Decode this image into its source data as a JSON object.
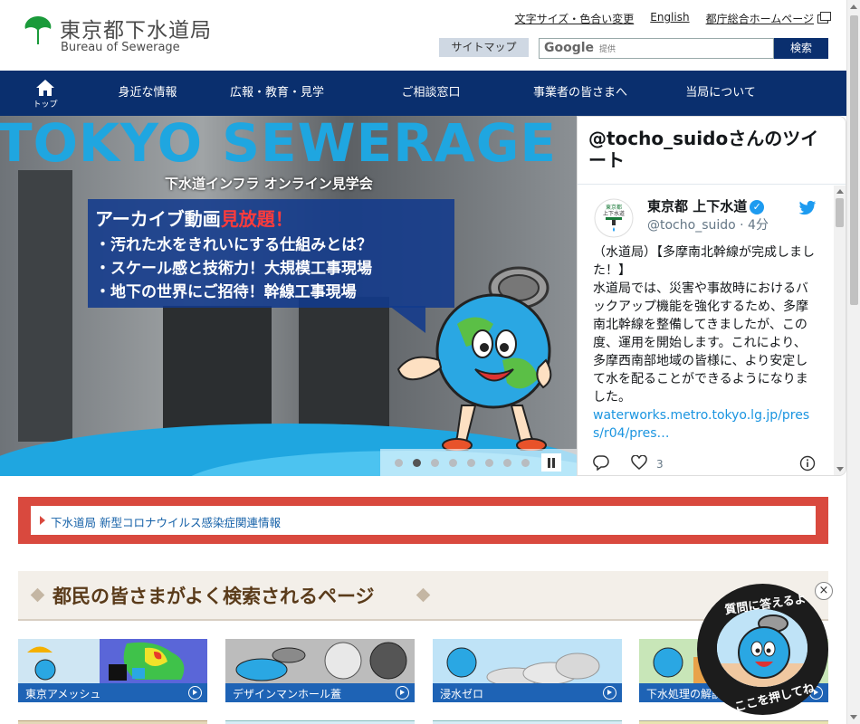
{
  "header": {
    "logo_jp": "東京都下水道局",
    "logo_en": "Bureau of Sewerage",
    "util_links": [
      {
        "label": "文字サイズ・色合い変更"
      },
      {
        "label": "English"
      },
      {
        "label": "都庁総合ホームページ"
      }
    ],
    "sitemap_label": "サイトマップ",
    "search": {
      "brand": "Google",
      "brand_suffix": "提供",
      "value": "",
      "button_label": "検索"
    }
  },
  "nav": {
    "home_label": "トップ",
    "items": [
      {
        "label": "身近な情報"
      },
      {
        "label": "広報・教育・見学"
      },
      {
        "label": "ご相談窓口"
      },
      {
        "label": "事業者の皆さまへ"
      },
      {
        "label": "当局について"
      }
    ]
  },
  "hero": {
    "title": "TOKYO SEWERAGE",
    "subtitle": "下水道インフラ オンライン見学会",
    "headline_a": "アーカイブ動画",
    "headline_b": "見放題！",
    "bullets": [
      "・汚れた水をきれいにする仕組みとは？",
      "・スケール感と技術力！大規模工事現場",
      "・地下の世界にご招待！幹線工事現場"
    ],
    "slide_count": 8,
    "active_slide": 2,
    "colors": {
      "title": "#1fa6e0",
      "panel": "#123a8c",
      "accent": "#ff3b3b"
    }
  },
  "twitter": {
    "header": "@tocho_suidoさんのツイート",
    "account_name": "東京都 上下水道",
    "handle": "@tocho_suido · 4分",
    "avatar_line1": "東京都",
    "avatar_line2": "上下水道",
    "text": "（水道局）【多摩南北幹線が完成しました！】\n水道局では、災害や事故時におけるバックアップ機能を強化するため、多摩南北幹線を整備してきましたが、この度、運用を開始します。これにより、多摩西南部地域の皆様に、より安定して水を配ることができるようになりました。",
    "link": "waterworks.metro.tokyo.lg.jp/press/r04/pres…",
    "like_count": "3"
  },
  "covid": {
    "label": "下水道局 新型コロナウイルス感染症関連情報"
  },
  "popular": {
    "title": "都民の皆さまがよく検索されるページ",
    "cards": [
      {
        "label": "東京アメッシュ"
      },
      {
        "label": "デザインマンホール蓋"
      },
      {
        "label": "浸水ゼロ"
      },
      {
        "label": "下水処理の解説"
      }
    ]
  },
  "chatbot": {
    "text_top": "質問に答えるよ",
    "text_bottom": "ここを押してね",
    "close": "×"
  },
  "colors": {
    "brand_navy": "#0a2f6e",
    "covid_red": "#d9493e",
    "card_blue": "#1e63b5",
    "popular_brown": "#5a3b1a"
  }
}
